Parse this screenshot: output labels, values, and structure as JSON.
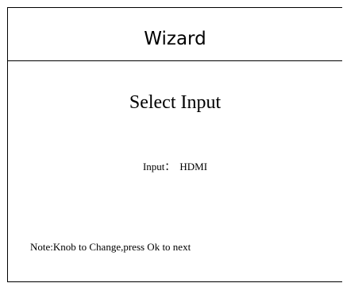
{
  "header": {
    "title": "Wizard"
  },
  "main": {
    "title": "Select Input",
    "input_label": "Input：",
    "input_value": "HDMI",
    "note": "Note:Knob to Change,press Ok to next"
  },
  "colors": {
    "background": "#ffffff",
    "border": "#000000",
    "text": "#000000"
  }
}
